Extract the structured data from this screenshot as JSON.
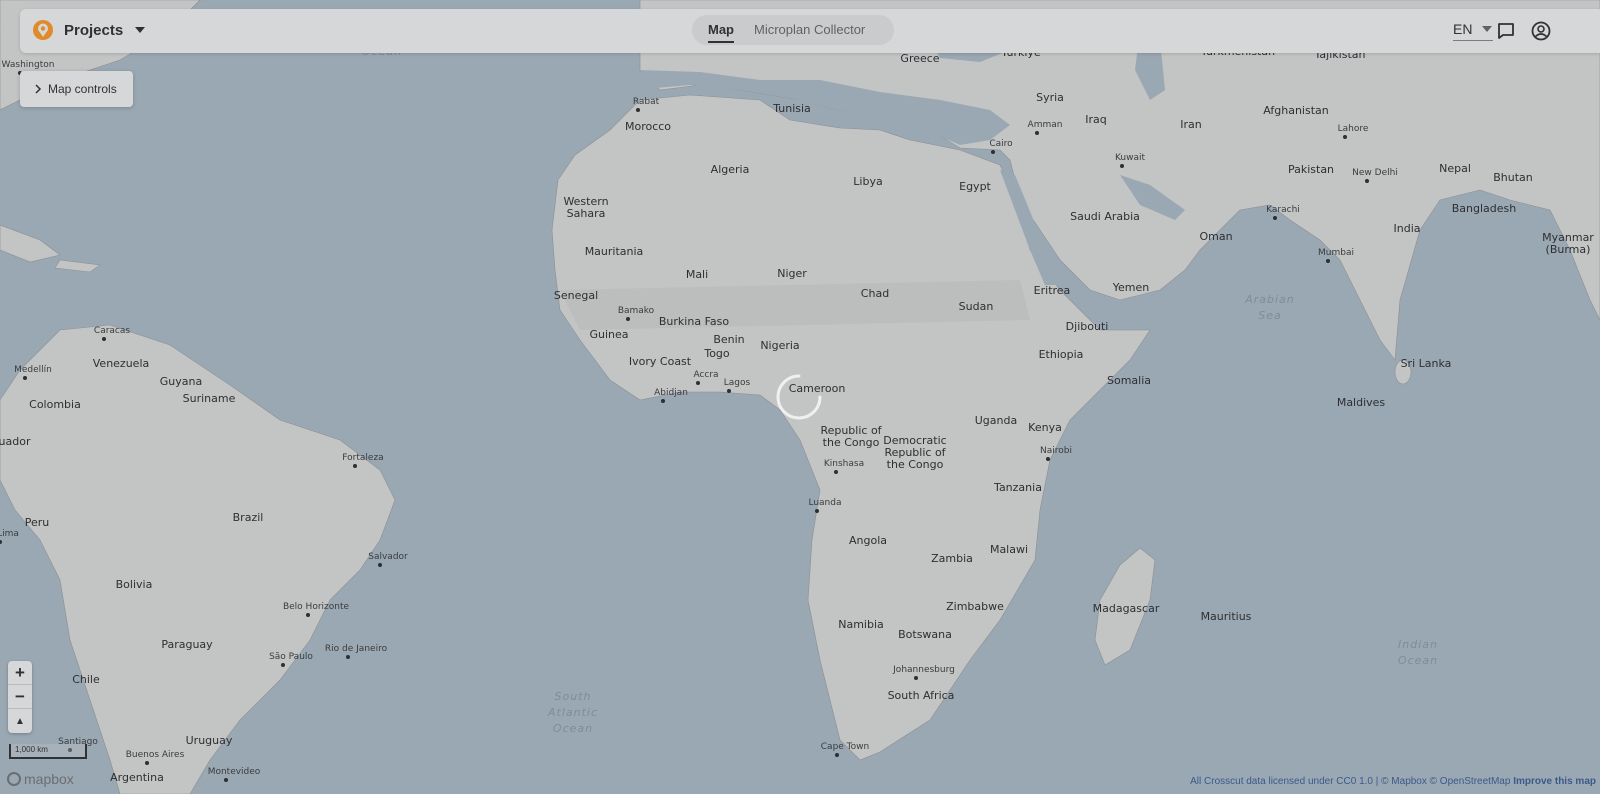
{
  "header": {
    "project_label": "Projects",
    "tabs": [
      {
        "label": "Map",
        "active": true
      },
      {
        "label": "Microplan Collector",
        "active": false
      }
    ],
    "language": "EN"
  },
  "map_controls": {
    "label": "Map controls"
  },
  "zoom": {
    "in": "+",
    "out": "−",
    "compass": "▲"
  },
  "scale_bar": {
    "label": "1,000 km"
  },
  "mapbox_logo": "mapbox",
  "attribution": {
    "text": "All Crosscut data licensed under CC0 1.0 | © Mapbox © OpenStreetMap",
    "improve": "Improve this map"
  },
  "map_labels": {
    "countries": [
      "Morocco",
      "Tunisia",
      "Algeria",
      "Libya",
      "Egypt",
      "Western Sahara",
      "Mauritania",
      "Mali",
      "Niger",
      "Chad",
      "Sudan",
      "Senegal",
      "Burkina Faso",
      "Guinea",
      "Ivory Coast",
      "Benin",
      "Togo",
      "Nigeria",
      "Cameroon",
      "Eritrea",
      "Djibouti",
      "Ethiopia",
      "Somalia",
      "Kenya",
      "Uganda",
      "Tanzania",
      "Republic of the Congo",
      "Democratic Republic of the Congo",
      "Angola",
      "Zambia",
      "Malawi",
      "Zimbabwe",
      "Namibia",
      "Botswana",
      "South Africa",
      "Madagascar",
      "Greece",
      "Türkiye",
      "Turkmenistan",
      "Tajikistan",
      "Syria",
      "Iraq",
      "Iran",
      "Afghanistan",
      "Pakistan",
      "Saudi Arabia",
      "Oman",
      "Yemen",
      "India",
      "Nepal",
      "Bhutan",
      "Bangladesh",
      "Myanmar (Burma)",
      "Sri Lanka",
      "Maldives",
      "Mauritius",
      "Venezuela",
      "Guyana",
      "Suriname",
      "Colombia",
      "Peru",
      "Brazil",
      "Bolivia",
      "Paraguay",
      "Chile",
      "Uruguay",
      "Argentina",
      "Ecuador"
    ],
    "cities": [
      "Rabat",
      "Cairo",
      "Amman",
      "Kuwait",
      "Lahore",
      "New Delhi",
      "Karachi",
      "Mumbai",
      "Bamako",
      "Abidjan",
      "Accra",
      "Lagos",
      "Kinshasa",
      "Luanda",
      "Nairobi",
      "Johannesburg",
      "Cape Town",
      "Caracas",
      "Medellín",
      "Fortaleza",
      "Salvador",
      "Belo Horizonte",
      "São Paulo",
      "Rio de Janeiro",
      "Santiago",
      "Buenos Aires",
      "Montevideo",
      "Washington",
      "Lima"
    ],
    "oceans": [
      "Ocean",
      "Arabian Sea",
      "Indian Ocean",
      "South Atlantic Ocean"
    ]
  },
  "colors": {
    "water": "#9aa8b3",
    "land": "#c3c4c4",
    "topbar": "#d6d7d8"
  }
}
